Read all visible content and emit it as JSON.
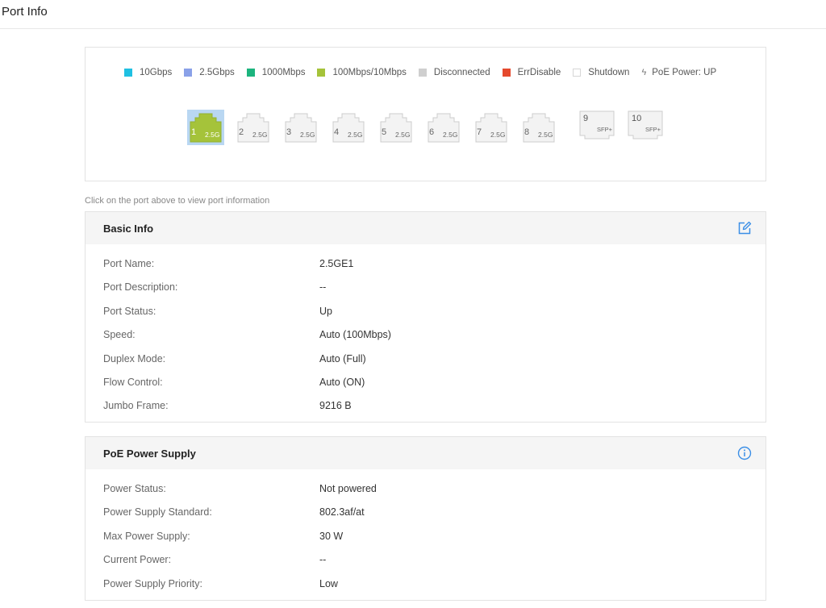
{
  "page": {
    "title": "Port Info"
  },
  "legend": [
    {
      "label": "10Gbps",
      "color": "#1fc0e2"
    },
    {
      "label": "2.5Gbps",
      "color": "#8aa1e8"
    },
    {
      "label": "1000Mbps",
      "color": "#1cb47e"
    },
    {
      "label": "100Mbps/10Mbps",
      "color": "#a5c33a"
    },
    {
      "label": "Disconnected",
      "color": "#cfcfcf"
    },
    {
      "label": "ErrDisable",
      "color": "#e5492d"
    },
    {
      "label": "Shutdown",
      "color": "#ffffff"
    }
  ],
  "legend_poe": {
    "label": "PoE Power: UP",
    "icon": "lightning-icon"
  },
  "ports": [
    {
      "num": "1",
      "speed": "2.5G",
      "state": "100Mbps/10Mbps",
      "selected": true
    },
    {
      "num": "2",
      "speed": "2.5G",
      "state": "Disconnected"
    },
    {
      "num": "3",
      "speed": "2.5G",
      "state": "Disconnected"
    },
    {
      "num": "4",
      "speed": "2.5G",
      "state": "Disconnected"
    },
    {
      "num": "5",
      "speed": "2.5G",
      "state": "Disconnected"
    },
    {
      "num": "6",
      "speed": "2.5G",
      "state": "Disconnected"
    },
    {
      "num": "7",
      "speed": "2.5G",
      "state": "Disconnected"
    },
    {
      "num": "8",
      "speed": "2.5G",
      "state": "Disconnected"
    }
  ],
  "sfp_ports": [
    {
      "num": "9",
      "label": "SFP+"
    },
    {
      "num": "10",
      "label": "SFP+"
    }
  ],
  "hint": "Click on the port above to view port information",
  "basic_info": {
    "title": "Basic Info",
    "icon": "edit-icon",
    "rows": [
      {
        "label": "Port Name:",
        "value": "2.5GE1"
      },
      {
        "label": "Port Description:",
        "value": "--"
      },
      {
        "label": "Port Status:",
        "value": "Up"
      },
      {
        "label": "Speed:",
        "value": "Auto (100Mbps)"
      },
      {
        "label": "Duplex Mode:",
        "value": "Auto (Full)"
      },
      {
        "label": "Flow Control:",
        "value": "Auto (ON)"
      },
      {
        "label": "Jumbo Frame:",
        "value": "9216 B"
      }
    ]
  },
  "poe": {
    "title": "PoE Power Supply",
    "icon": "info-icon",
    "rows": [
      {
        "label": "Power Status:",
        "value": "Not powered"
      },
      {
        "label": "Power Supply Standard:",
        "value": "802.3af/at"
      },
      {
        "label": "Max Power Supply:",
        "value": "30 W"
      },
      {
        "label": "Current Power:",
        "value": "--"
      },
      {
        "label": "Power Supply Priority:",
        "value": "Low"
      }
    ]
  },
  "colors": {
    "accent": "#3a8ee6",
    "port_active": "#a5c33a",
    "port_idle": "#f1f1f1",
    "selected_bg": "#b9d7f2"
  }
}
